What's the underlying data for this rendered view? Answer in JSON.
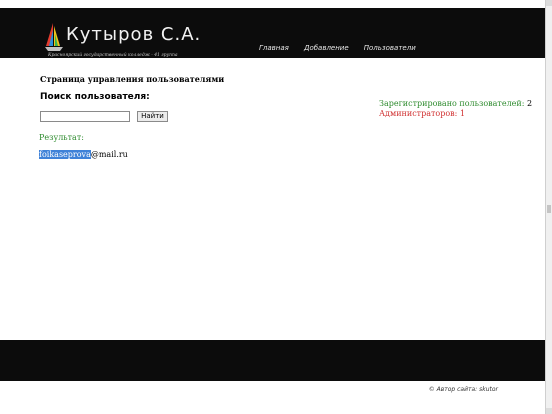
{
  "header": {
    "logo_icon": "sailboat-logo-icon",
    "title": "Кутыров С.А.",
    "subtitle": "Красноярский государственный колледж - 41 группа",
    "nav": [
      {
        "label": "Главная"
      },
      {
        "label": "Добавление"
      },
      {
        "label": "Пользователи"
      }
    ]
  },
  "main": {
    "page_title": "Страница управления пользователями",
    "search_heading": "Поиск пользователя:",
    "search_input_value": "",
    "search_button": "Найти",
    "result_label": "Результат:",
    "result_highlight": "foikaseprova",
    "result_rest": "@mail.ru"
  },
  "stats": {
    "registered_label": "Зарегистрировано пользователей:",
    "registered_count": "2",
    "admins_label": "Администраторов:",
    "admins_count": "1"
  },
  "footer": {
    "copyright": "© Автор сайта: skutor"
  },
  "colors": {
    "header_bg": "#0c0c0c",
    "result_green": "#2e8b2e",
    "admin_red": "#d03030",
    "highlight_blue": "#3f82d8"
  }
}
